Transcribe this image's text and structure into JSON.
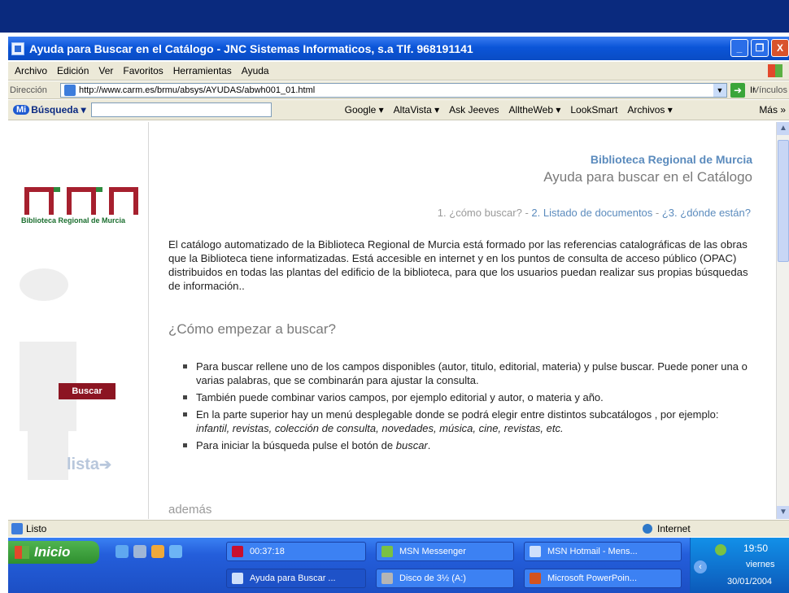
{
  "window": {
    "title": "Ayuda para Buscar en el Catálogo - JNC Sistemas Informaticos, s.a  Tlf. 968191141",
    "minimize": "_",
    "maximize": "❐",
    "close": "X"
  },
  "menu": [
    "Archivo",
    "Edición",
    "Ver",
    "Favoritos",
    "Herramientas",
    "Ayuda"
  ],
  "address": {
    "label": "Dirección",
    "url": "http://www.carm.es/brmu/absys/AYUDAS/abwh001_01.html",
    "go": "Ir",
    "links": "Vínculos"
  },
  "searchbar": {
    "badge": "Mi",
    "label": "Búsqueda",
    "engines": [
      "Google",
      "AltaVista",
      "Ask Jeeves",
      "AlltheWeb",
      "LookSmart",
      "Archivos"
    ],
    "more": "Más"
  },
  "sidebar": {
    "logo_text": "Biblioteca Regional de Murcia",
    "buscar": "Buscar",
    "lista": "lista"
  },
  "page": {
    "header_org": "Biblioteca Regional de Murcia",
    "header_title": "Ayuda para buscar en el Catálogo",
    "steps": {
      "s1": "1. ¿cómo buscar?",
      "sep": " - ",
      "s2": "2. Listado de documentos",
      "s3": "¿3. ¿dónde están?"
    },
    "intro": "El catálogo automatizado de la Biblioteca Regional de Murcia está formado por las referencias catalográficas de las obras que la Biblioteca tiene informatizadas. Está accesible en internet y en los puntos de consulta de acceso público (OPAC) distribuidos en todas las plantas del edificio de la biblioteca, para que los usuarios puedan realizar sus propias búsquedas de información..",
    "heading": "¿Cómo empezar a buscar?",
    "bullets": [
      {
        "text": "Para buscar rellene uno de los campos disponibles (autor, titulo, editorial, materia) y pulse buscar. Puede poner una o varias palabras, que se combinarán para ajustar la consulta."
      },
      {
        "text": "También puede combinar varios campos, por ejemplo editorial y autor, o materia y año."
      },
      {
        "pre": "En la parte superior hay un menú desplegable donde se podrá elegir entre distintos subcatálogos , por ejemplo: ",
        "em": "infantil, revistas, colección de consulta, novedades, música, cine, revistas, etc."
      },
      {
        "pre": "Para iniciar la búsqueda pulse el botón de ",
        "em": "buscar",
        "post": "."
      }
    ],
    "ademas": "además"
  },
  "status": {
    "text": "Listo",
    "zone": "Internet"
  },
  "taskbar": {
    "start": "Inicio",
    "row1": [
      "00:37:18",
      "MSN Messenger",
      "MSN Hotmail - Mens..."
    ],
    "row2": [
      "Ayuda para Buscar ...",
      "Disco de 3½ (A:)",
      "Microsoft PowerPoin..."
    ],
    "time": "19:50",
    "day": "viernes",
    "date": "30/01/2004"
  },
  "colors": {
    "accent": "#5b8bbd",
    "buscar_button": "#8c1522",
    "logo_red": "#a6202e",
    "logo_green": "#2e8b3e"
  }
}
